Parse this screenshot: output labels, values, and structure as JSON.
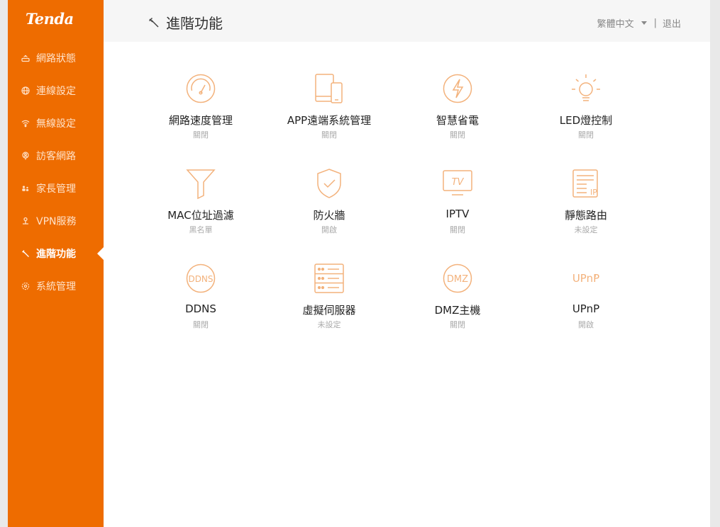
{
  "brand": {
    "logo_text": "Tenda",
    "accent_color": "#ee6c00"
  },
  "sidebar": {
    "items": [
      {
        "label": "網路狀態",
        "icon": "router-icon",
        "active": false
      },
      {
        "label": "連線設定",
        "icon": "globe-icon",
        "active": false
      },
      {
        "label": "無線設定",
        "icon": "wifi-icon",
        "active": false
      },
      {
        "label": "訪客網路",
        "icon": "guest-icon",
        "active": false
      },
      {
        "label": "家長管理",
        "icon": "parental-icon",
        "active": false
      },
      {
        "label": "VPN服務",
        "icon": "vpn-icon",
        "active": false
      },
      {
        "label": "進階功能",
        "icon": "wrench-icon",
        "active": true
      },
      {
        "label": "系統管理",
        "icon": "settings-icon",
        "active": false
      }
    ]
  },
  "header": {
    "title": "進階功能",
    "language": "繁體中文",
    "separator": "|",
    "logout": "退出"
  },
  "features": [
    {
      "label": "網路速度管理",
      "status": "關閉",
      "icon": "speedometer-icon"
    },
    {
      "label": "APP遠端系統管理",
      "status": "關閉",
      "icon": "devices-icon"
    },
    {
      "label": "智慧省電",
      "status": "關閉",
      "icon": "power-save-icon"
    },
    {
      "label": "LED燈控制",
      "status": "關閉",
      "icon": "bulb-icon"
    },
    {
      "label": "MAC位址過濾",
      "status": "黑名單",
      "icon": "filter-icon"
    },
    {
      "label": "防火牆",
      "status": "開啟",
      "icon": "shield-icon"
    },
    {
      "label": "IPTV",
      "status": "關閉",
      "icon": "tv-icon"
    },
    {
      "label": "靜態路由",
      "status": "未設定",
      "icon": "static-route-icon"
    },
    {
      "label": "DDNS",
      "status": "關閉",
      "icon": "ddns-icon"
    },
    {
      "label": "虛擬伺服器",
      "status": "未設定",
      "icon": "server-icon"
    },
    {
      "label": "DMZ主機",
      "status": "關閉",
      "icon": "dmz-icon"
    },
    {
      "label": "UPnP",
      "status": "開啟",
      "icon": "upnp-icon"
    }
  ],
  "icon_text": {
    "tv": "TV",
    "ip": "IP",
    "ddns": "DDNS",
    "dmz": "DMZ",
    "upnp": "UPnP"
  }
}
